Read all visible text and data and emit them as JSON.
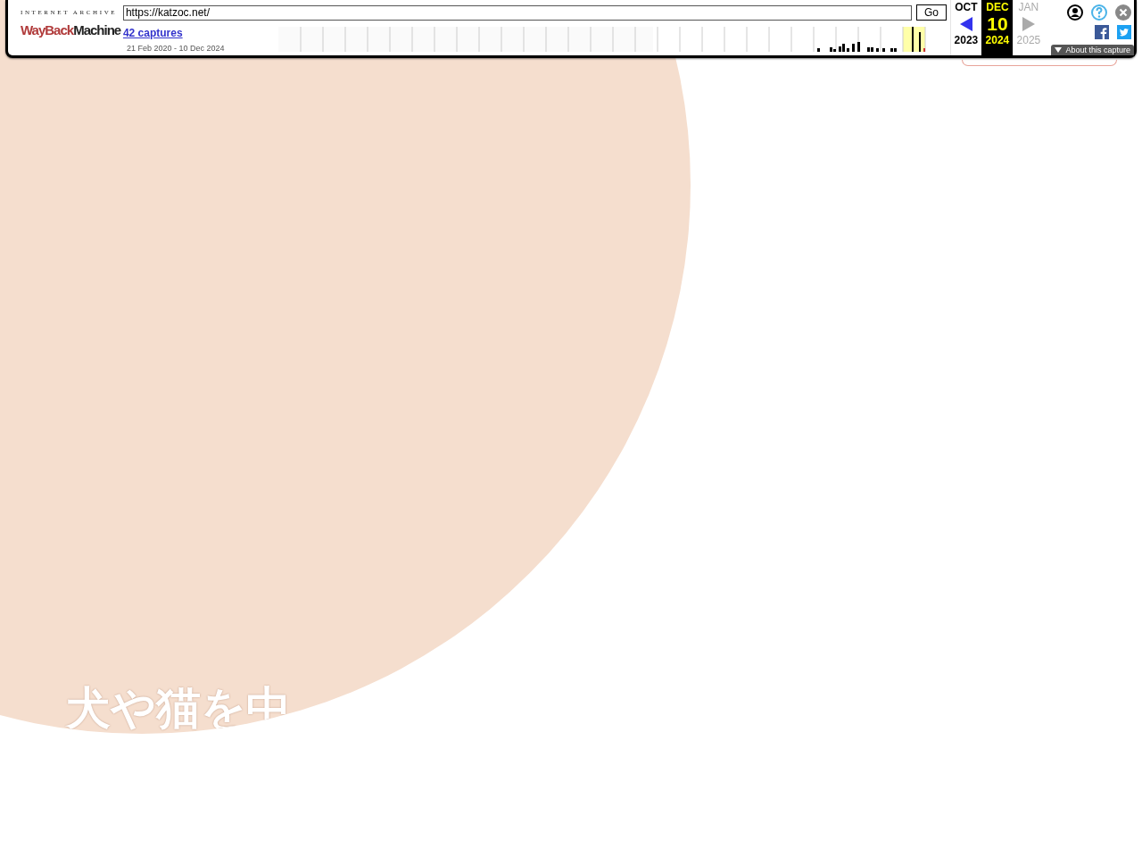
{
  "toolbar": {
    "logo": {
      "caption": "INTERNET ARCHIVE",
      "word_1": "WayBack",
      "word_2": "Machine"
    },
    "url_field": {
      "value": "https://katzoc.net/"
    },
    "go_button": "Go",
    "captures_link": "42 captures",
    "date_range": "21 Feb 2020 - 10 Dec 2024",
    "calendar": [
      {
        "kind": "prev",
        "month": "OCT",
        "year": "2023",
        "selected": false,
        "disabled": false
      },
      {
        "kind": "current",
        "month": "DEC",
        "day": "10",
        "year": "2024",
        "selected": true,
        "disabled": false
      },
      {
        "kind": "next",
        "month": "JAN",
        "year": "2025",
        "selected": false,
        "disabled": true
      }
    ],
    "about_button": "About this capture"
  },
  "page": {
    "headline": "犬や猫を中"
  }
}
